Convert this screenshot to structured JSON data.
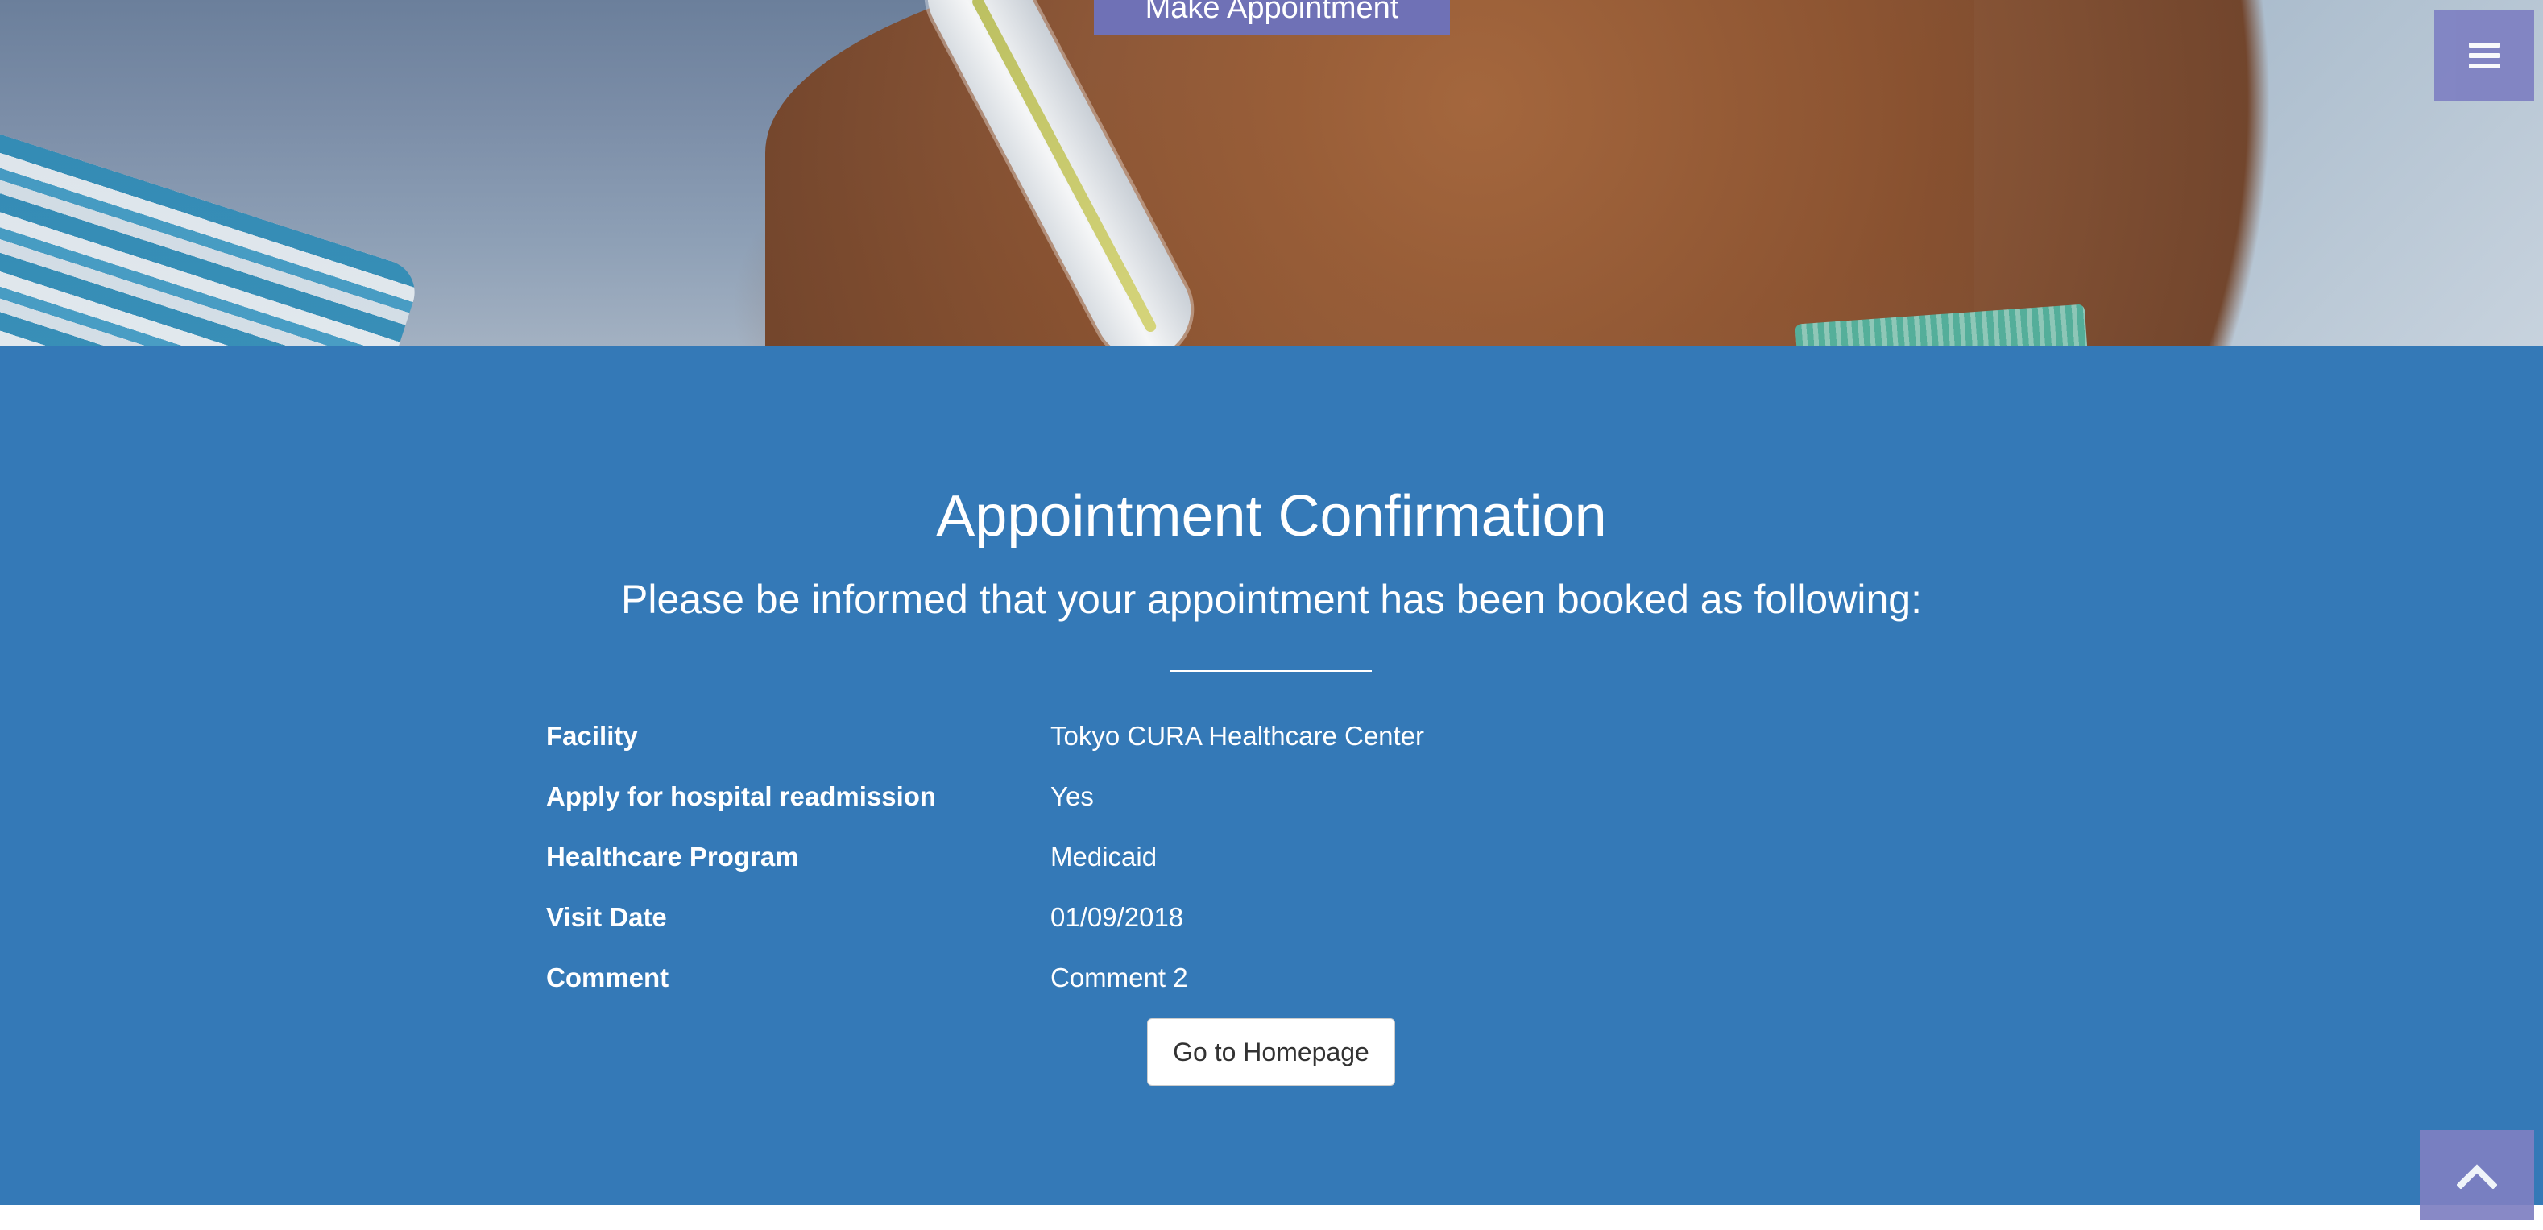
{
  "hero": {
    "make_appointment_label": "Make Appointment",
    "menu_icon": "hamburger-menu-icon"
  },
  "confirmation": {
    "title": "Appointment Confirmation",
    "subtitle": "Please be informed that your appointment has been booked as following:",
    "details": [
      {
        "label": "Facility",
        "value": "Tokyo CURA Healthcare Center"
      },
      {
        "label": "Apply for hospital readmission",
        "value": "Yes"
      },
      {
        "label": "Healthcare Program",
        "value": "Medicaid"
      },
      {
        "label": "Visit Date",
        "value": "01/09/2018"
      },
      {
        "label": "Comment",
        "value": "Comment 2"
      }
    ],
    "home_button_label": "Go to Homepage"
  },
  "scroll_to_top": {
    "icon": "chevron-up-icon"
  },
  "colors": {
    "section_background": "#3479b7",
    "accent_button": "#6f71b6",
    "floating_button": "#7e80c2"
  }
}
